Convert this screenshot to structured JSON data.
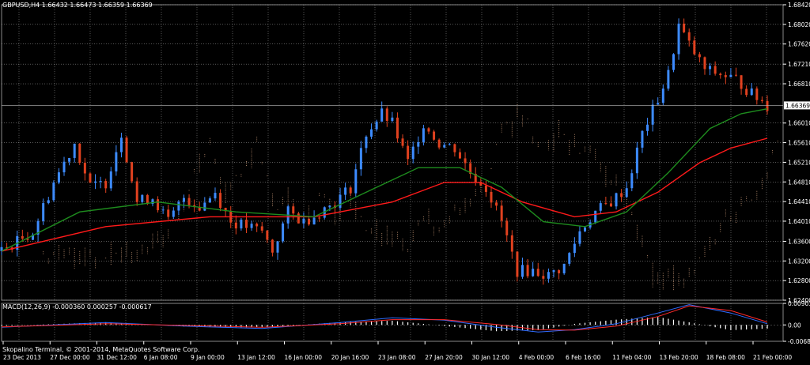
{
  "header": {
    "title": "GBPUSD,H4  1.66432 1.66473 1.66359 1.66369",
    "copyright": "Skopalino Terminal, © 2001-2014, MetaQuotes Software Corp."
  },
  "colors": {
    "background": "#000000",
    "grid": "#c8c8c8",
    "bull": "#3d8bff",
    "bear": "#e0411f",
    "ma_red": "#ff1a1a",
    "ma_green": "#1e8c1e",
    "ichimoku": "#f0b890",
    "macd_blue": "#2f6cff",
    "macd_red": "#ff2a2a"
  },
  "chart_data": [
    {
      "type": "candlestick",
      "symbol": "GBPUSD",
      "timeframe": "H4",
      "ohlc_last": {
        "open": 1.66432,
        "high": 1.66473,
        "low": 1.66359,
        "close": 1.66369
      },
      "current_price_label": "1.66369",
      "current_price": 1.66369,
      "y_ticks": [
        "1.68420",
        "1.68020",
        "1.67620",
        "1.67210",
        "1.66810",
        "1.66010",
        "1.65610",
        "1.65210",
        "1.64810",
        "1.64410",
        "1.64010",
        "1.63600",
        "1.63200",
        "1.62800",
        "1.62400"
      ],
      "ylim": [
        1.624,
        1.6842
      ],
      "x_labels": [
        "23 Dec 2013",
        "27 Dec 00:00",
        "31 Dec 12:00",
        "6 Jan 08:00",
        "9 Jan 00:00",
        "13 Jan 12:00",
        "16 Jan 00:00",
        "20 Jan 16:00",
        "23 Jan 08:00",
        "27 Jan 20:00",
        "30 Jan 12:00",
        "4 Feb 00:00",
        "6 Feb 16:00",
        "11 Feb 04:00",
        "13 Feb 20:00",
        "18 Feb 08:00",
        "21 Feb 00:00"
      ],
      "approx_close_path": [
        [
          0,
          1.634
        ],
        [
          6,
          1.638
        ],
        [
          10,
          1.648
        ],
        [
          14,
          1.656
        ],
        [
          17,
          1.647
        ],
        [
          20,
          1.648
        ],
        [
          23,
          1.658
        ],
        [
          26,
          1.644
        ],
        [
          29,
          1.645
        ],
        [
          32,
          1.64
        ],
        [
          35,
          1.645
        ],
        [
          38,
          1.643
        ],
        [
          41,
          1.646
        ],
        [
          44,
          1.64
        ],
        [
          47,
          1.639
        ],
        [
          50,
          1.638
        ],
        [
          52,
          1.634
        ],
        [
          55,
          1.642
        ],
        [
          58,
          1.64
        ],
        [
          61,
          1.642
        ],
        [
          64,
          1.644
        ],
        [
          67,
          1.647
        ],
        [
          70,
          1.658
        ],
        [
          73,
          1.662
        ],
        [
          75,
          1.66
        ],
        [
          78,
          1.652
        ],
        [
          81,
          1.66
        ],
        [
          84,
          1.656
        ],
        [
          87,
          1.655
        ],
        [
          90,
          1.65
        ],
        [
          93,
          1.647
        ],
        [
          96,
          1.64
        ],
        [
          99,
          1.63
        ],
        [
          102,
          1.63
        ],
        [
          105,
          1.629
        ],
        [
          108,
          1.631
        ],
        [
          111,
          1.638
        ],
        [
          114,
          1.642
        ],
        [
          117,
          1.644
        ],
        [
          120,
          1.647
        ],
        [
          123,
          1.658
        ],
        [
          126,
          1.665
        ],
        [
          128,
          1.67
        ],
        [
          130,
          1.68
        ],
        [
          132,
          1.676
        ],
        [
          135,
          1.671
        ],
        [
          138,
          1.67
        ],
        [
          141,
          1.669
        ],
        [
          144,
          1.666
        ],
        [
          147,
          1.6637
        ]
      ],
      "moving_averages": [
        {
          "color": "#ff1a1a",
          "points": [
            [
              0,
              1.634
            ],
            [
              20,
              1.639
            ],
            [
              40,
              1.641
            ],
            [
              60,
              1.641
            ],
            [
              75,
              1.644
            ],
            [
              85,
              1.648
            ],
            [
              92,
              1.648
            ],
            [
              100,
              1.644
            ],
            [
              110,
              1.641
            ],
            [
              118,
              1.642
            ],
            [
              126,
              1.646
            ],
            [
              134,
              1.652
            ],
            [
              140,
              1.655
            ],
            [
              147,
              1.657
            ]
          ]
        },
        {
          "color": "#1e8c1e",
          "points": [
            [
              0,
              1.634
            ],
            [
              15,
              1.642
            ],
            [
              30,
              1.644
            ],
            [
              45,
              1.642
            ],
            [
              60,
              1.641
            ],
            [
              70,
              1.646
            ],
            [
              80,
              1.651
            ],
            [
              88,
              1.651
            ],
            [
              96,
              1.647
            ],
            [
              104,
              1.64
            ],
            [
              112,
              1.639
            ],
            [
              120,
              1.642
            ],
            [
              128,
              1.65
            ],
            [
              136,
              1.659
            ],
            [
              142,
              1.662
            ],
            [
              147,
              1.663
            ]
          ]
        }
      ]
    },
    {
      "type": "macd",
      "title": "MACD(12,26,9) -0.000360 0.000257 -0.000617",
      "y_ticks": [
        "0.00903",
        "0.00",
        "-0.00687"
      ],
      "ylim": [
        -0.00687,
        0.00903
      ],
      "macd_line": [
        [
          0,
          -0.001
        ],
        [
          20,
          0.001
        ],
        [
          35,
          -0.0005
        ],
        [
          50,
          -0.0015
        ],
        [
          65,
          0.001
        ],
        [
          75,
          0.003
        ],
        [
          85,
          0.002
        ],
        [
          95,
          -0.001
        ],
        [
          103,
          -0.003
        ],
        [
          110,
          -0.002
        ],
        [
          118,
          0.0005
        ],
        [
          126,
          0.005
        ],
        [
          132,
          0.0085
        ],
        [
          140,
          0.005
        ],
        [
          147,
          0.0005
        ]
      ],
      "signal_line": [
        [
          0,
          -0.0008
        ],
        [
          20,
          0.0005
        ],
        [
          35,
          -0.0002
        ],
        [
          50,
          -0.001
        ],
        [
          65,
          0.0005
        ],
        [
          75,
          0.0022
        ],
        [
          85,
          0.0022
        ],
        [
          95,
          0.0002
        ],
        [
          103,
          -0.002
        ],
        [
          110,
          -0.0022
        ],
        [
          118,
          -0.0005
        ],
        [
          126,
          0.0035
        ],
        [
          132,
          0.008
        ],
        [
          140,
          0.006
        ],
        [
          147,
          0.0012
        ]
      ]
    }
  ]
}
